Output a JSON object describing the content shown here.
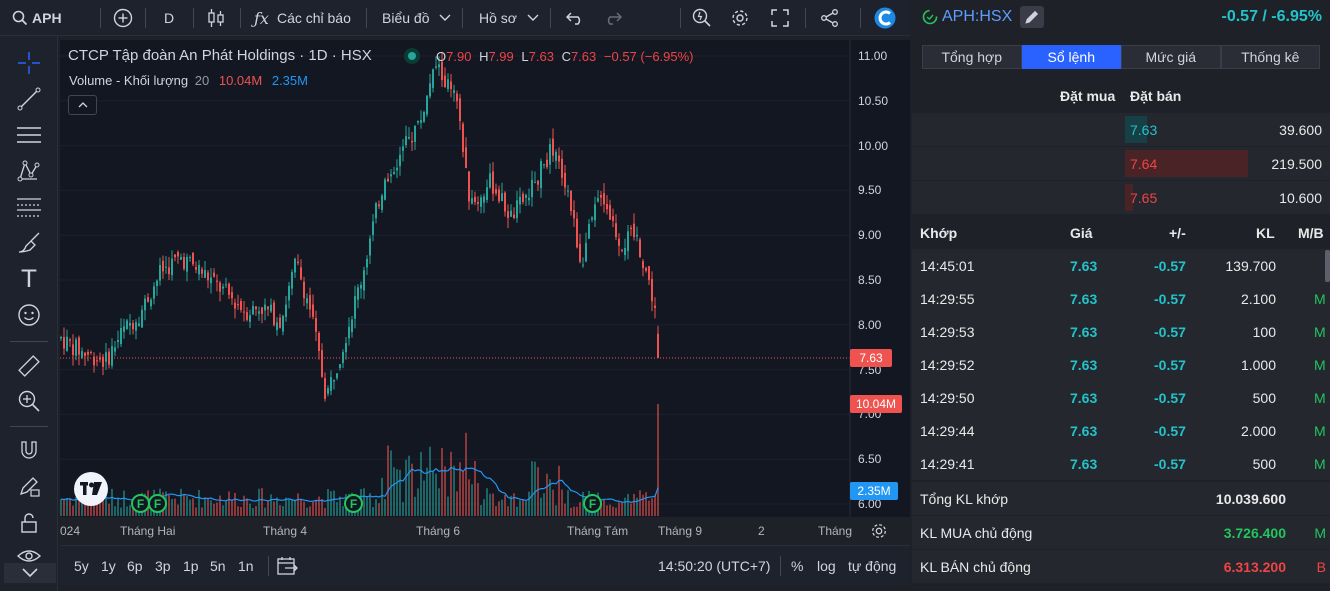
{
  "toolbar": {
    "symbol": "APH",
    "interval": "D",
    "indicators_label": "Các chỉ báo",
    "chart_label": "Biểu đồ",
    "profile_label": "Hồ sơ"
  },
  "chart_header": {
    "title": "CTCP Tập đoàn An Phát Holdings · 1D · HSX",
    "o_label": "O",
    "o_value": "7.90",
    "h_label": "H",
    "h_value": "7.99",
    "l_label": "L",
    "l_value": "7.63",
    "c_label": "C",
    "c_value": "7.63",
    "change": "−0.57 (−6.95%)",
    "volume_label": "Volume - Khối lượng",
    "volume_period": "20",
    "volume_value": "10.04M",
    "volume_ma": "2.35M"
  },
  "price_axis": [
    "11.00",
    "10.50",
    "10.00",
    "9.50",
    "9.00",
    "8.50",
    "8.00",
    "7.50",
    "7.00",
    "6.50",
    "6.00"
  ],
  "price_tag": "7.63",
  "volume_tag": "10.04M",
  "volume_ma_tag": "2.35M",
  "time_axis": [
    "024",
    "Tháng Hai",
    "Tháng 4",
    "Tháng 6",
    "Tháng Tám",
    "Tháng 9",
    "2",
    "Tháng"
  ],
  "ranges": [
    "5y",
    "1y",
    "6p",
    "3p",
    "1p",
    "5n",
    "1n"
  ],
  "clock": "14:50:20 (UTC+7)",
  "scale_buttons": [
    "%",
    "log",
    "tự động"
  ],
  "event_marker": "F",
  "panel": {
    "symbol": "APH:HSX",
    "change": "-0.57 / -6.95%",
    "tabs": [
      "Tổng hợp",
      "Sổ lệnh",
      "Mức giá",
      "Thống kê"
    ],
    "book_headers": {
      "bid": "Đặt mua",
      "ask": "Đặt bán"
    },
    "book": [
      {
        "price": "7.63",
        "volume": "39.600"
      },
      {
        "price": "7.64",
        "volume": "219.500"
      },
      {
        "price": "7.65",
        "volume": "10.600"
      }
    ],
    "trade_headers": [
      "Khớp",
      "Giá",
      "+/-",
      "KL",
      "M/B"
    ],
    "trades": [
      {
        "time": "14:45:01",
        "price": "7.63",
        "change": "-0.57",
        "volume": "139.700",
        "side": ""
      },
      {
        "time": "14:29:55",
        "price": "7.63",
        "change": "-0.57",
        "volume": "2.100",
        "side": "M"
      },
      {
        "time": "14:29:53",
        "price": "7.63",
        "change": "-0.57",
        "volume": "100",
        "side": "M"
      },
      {
        "time": "14:29:52",
        "price": "7.63",
        "change": "-0.57",
        "volume": "1.000",
        "side": "M"
      },
      {
        "time": "14:29:50",
        "price": "7.63",
        "change": "-0.57",
        "volume": "500",
        "side": "M"
      },
      {
        "time": "14:29:44",
        "price": "7.63",
        "change": "-0.57",
        "volume": "2.000",
        "side": "M"
      },
      {
        "time": "14:29:41",
        "price": "7.63",
        "change": "-0.57",
        "volume": "500",
        "side": "M"
      }
    ],
    "summary": {
      "total_label": "Tổng KL khớp",
      "total_value": "10.039.600",
      "buy_label": "KL MUA chủ động",
      "buy_value": "3.726.400",
      "buy_side": "M",
      "sell_label": "KL BÁN chủ động",
      "sell_value": "6.313.200",
      "sell_side": "B"
    }
  },
  "colors": {
    "up": "#26a69a",
    "down": "#ef5350",
    "accent": "#2962ff",
    "bg": "#131722"
  }
}
